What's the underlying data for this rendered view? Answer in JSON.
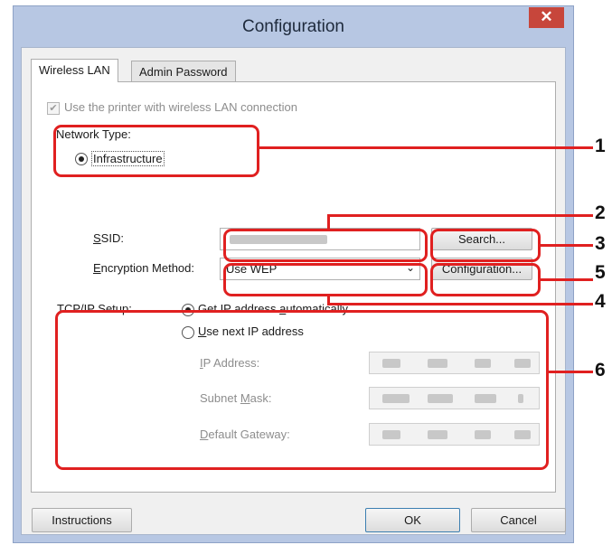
{
  "window": {
    "title": "Configuration",
    "close_glyph": "✕"
  },
  "tabs": [
    {
      "label": "Wireless LAN",
      "active": true
    },
    {
      "label": "Admin Password",
      "active": false
    }
  ],
  "wireless": {
    "use_printer_label": "Use the printer with wireless LAN connection",
    "use_printer_checked": true,
    "network_type_label": "Network Type:",
    "infrastructure_label": "Infrastructure",
    "ssid_label": "SSID:",
    "encryption_label": "Encryption Method:",
    "encryption_value": "Use WEP",
    "search_button": "Search...",
    "configuration_button": "Configuration..."
  },
  "tcpip": {
    "label": "TCP/IP Setup:",
    "auto_label": "Get IP address automatically",
    "auto_selected": true,
    "manual_label": "Use next IP address",
    "ip_label": "IP Address:",
    "subnet_label": "Subnet Mask:",
    "gateway_label": "Default Gateway:"
  },
  "footer": {
    "instructions": "Instructions",
    "ok": "OK",
    "cancel": "Cancel"
  },
  "callouts": [
    "1",
    "2",
    "3",
    "4",
    "5",
    "6"
  ],
  "colors": {
    "annotation": "#e02020",
    "titlebar": "#b7c7e3",
    "close": "#c7463b"
  }
}
